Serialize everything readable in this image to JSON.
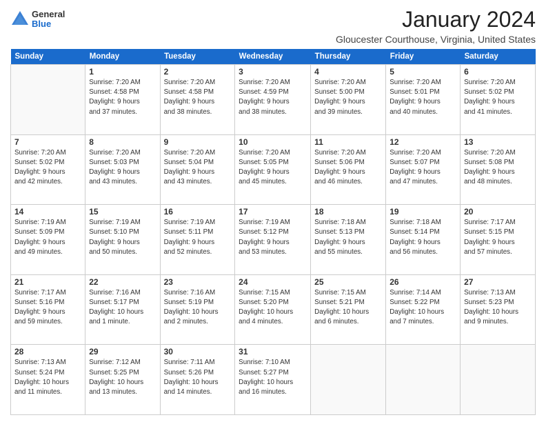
{
  "logo": {
    "general": "General",
    "blue": "Blue"
  },
  "header": {
    "title": "January 2024",
    "location": "Gloucester Courthouse, Virginia, United States"
  },
  "days_of_week": [
    "Sunday",
    "Monday",
    "Tuesday",
    "Wednesday",
    "Thursday",
    "Friday",
    "Saturday"
  ],
  "weeks": [
    [
      {
        "day": "",
        "info": ""
      },
      {
        "day": "1",
        "info": "Sunrise: 7:20 AM\nSunset: 4:58 PM\nDaylight: 9 hours\nand 37 minutes."
      },
      {
        "day": "2",
        "info": "Sunrise: 7:20 AM\nSunset: 4:58 PM\nDaylight: 9 hours\nand 38 minutes."
      },
      {
        "day": "3",
        "info": "Sunrise: 7:20 AM\nSunset: 4:59 PM\nDaylight: 9 hours\nand 38 minutes."
      },
      {
        "day": "4",
        "info": "Sunrise: 7:20 AM\nSunset: 5:00 PM\nDaylight: 9 hours\nand 39 minutes."
      },
      {
        "day": "5",
        "info": "Sunrise: 7:20 AM\nSunset: 5:01 PM\nDaylight: 9 hours\nand 40 minutes."
      },
      {
        "day": "6",
        "info": "Sunrise: 7:20 AM\nSunset: 5:02 PM\nDaylight: 9 hours\nand 41 minutes."
      }
    ],
    [
      {
        "day": "7",
        "info": "Sunrise: 7:20 AM\nSunset: 5:02 PM\nDaylight: 9 hours\nand 42 minutes."
      },
      {
        "day": "8",
        "info": "Sunrise: 7:20 AM\nSunset: 5:03 PM\nDaylight: 9 hours\nand 43 minutes."
      },
      {
        "day": "9",
        "info": "Sunrise: 7:20 AM\nSunset: 5:04 PM\nDaylight: 9 hours\nand 43 minutes."
      },
      {
        "day": "10",
        "info": "Sunrise: 7:20 AM\nSunset: 5:05 PM\nDaylight: 9 hours\nand 45 minutes."
      },
      {
        "day": "11",
        "info": "Sunrise: 7:20 AM\nSunset: 5:06 PM\nDaylight: 9 hours\nand 46 minutes."
      },
      {
        "day": "12",
        "info": "Sunrise: 7:20 AM\nSunset: 5:07 PM\nDaylight: 9 hours\nand 47 minutes."
      },
      {
        "day": "13",
        "info": "Sunrise: 7:20 AM\nSunset: 5:08 PM\nDaylight: 9 hours\nand 48 minutes."
      }
    ],
    [
      {
        "day": "14",
        "info": "Sunrise: 7:19 AM\nSunset: 5:09 PM\nDaylight: 9 hours\nand 49 minutes."
      },
      {
        "day": "15",
        "info": "Sunrise: 7:19 AM\nSunset: 5:10 PM\nDaylight: 9 hours\nand 50 minutes."
      },
      {
        "day": "16",
        "info": "Sunrise: 7:19 AM\nSunset: 5:11 PM\nDaylight: 9 hours\nand 52 minutes."
      },
      {
        "day": "17",
        "info": "Sunrise: 7:19 AM\nSunset: 5:12 PM\nDaylight: 9 hours\nand 53 minutes."
      },
      {
        "day": "18",
        "info": "Sunrise: 7:18 AM\nSunset: 5:13 PM\nDaylight: 9 hours\nand 55 minutes."
      },
      {
        "day": "19",
        "info": "Sunrise: 7:18 AM\nSunset: 5:14 PM\nDaylight: 9 hours\nand 56 minutes."
      },
      {
        "day": "20",
        "info": "Sunrise: 7:17 AM\nSunset: 5:15 PM\nDaylight: 9 hours\nand 57 minutes."
      }
    ],
    [
      {
        "day": "21",
        "info": "Sunrise: 7:17 AM\nSunset: 5:16 PM\nDaylight: 9 hours\nand 59 minutes."
      },
      {
        "day": "22",
        "info": "Sunrise: 7:16 AM\nSunset: 5:17 PM\nDaylight: 10 hours\nand 1 minute."
      },
      {
        "day": "23",
        "info": "Sunrise: 7:16 AM\nSunset: 5:19 PM\nDaylight: 10 hours\nand 2 minutes."
      },
      {
        "day": "24",
        "info": "Sunrise: 7:15 AM\nSunset: 5:20 PM\nDaylight: 10 hours\nand 4 minutes."
      },
      {
        "day": "25",
        "info": "Sunrise: 7:15 AM\nSunset: 5:21 PM\nDaylight: 10 hours\nand 6 minutes."
      },
      {
        "day": "26",
        "info": "Sunrise: 7:14 AM\nSunset: 5:22 PM\nDaylight: 10 hours\nand 7 minutes."
      },
      {
        "day": "27",
        "info": "Sunrise: 7:13 AM\nSunset: 5:23 PM\nDaylight: 10 hours\nand 9 minutes."
      }
    ],
    [
      {
        "day": "28",
        "info": "Sunrise: 7:13 AM\nSunset: 5:24 PM\nDaylight: 10 hours\nand 11 minutes."
      },
      {
        "day": "29",
        "info": "Sunrise: 7:12 AM\nSunset: 5:25 PM\nDaylight: 10 hours\nand 13 minutes."
      },
      {
        "day": "30",
        "info": "Sunrise: 7:11 AM\nSunset: 5:26 PM\nDaylight: 10 hours\nand 14 minutes."
      },
      {
        "day": "31",
        "info": "Sunrise: 7:10 AM\nSunset: 5:27 PM\nDaylight: 10 hours\nand 16 minutes."
      },
      {
        "day": "",
        "info": ""
      },
      {
        "day": "",
        "info": ""
      },
      {
        "day": "",
        "info": ""
      }
    ]
  ]
}
